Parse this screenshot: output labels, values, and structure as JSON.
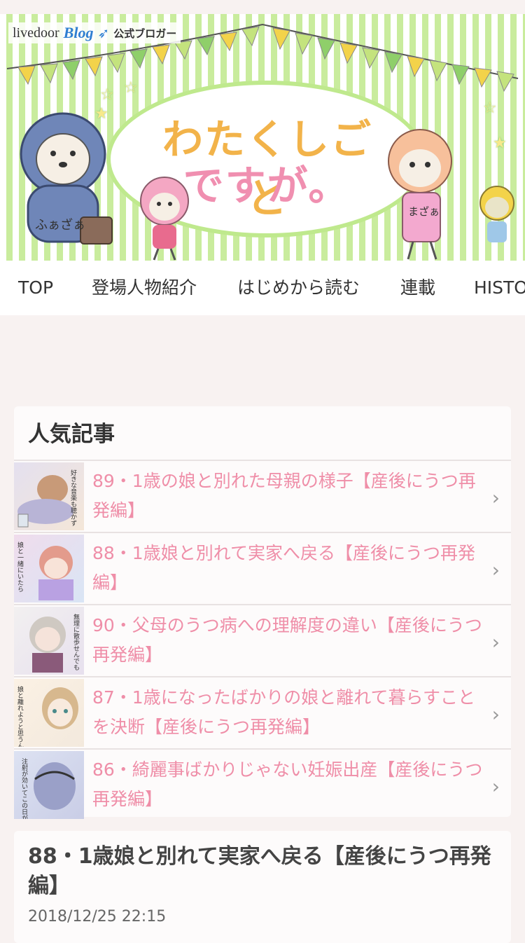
{
  "header": {
    "brand_livedoor": "livedoor",
    "brand_blog": "Blog",
    "brand_official": "公式ブロガー",
    "title_line1": "わたくしごと",
    "title_line2": "ですが。",
    "character_labels": [
      "ふぁざぁ",
      "まざぁ"
    ]
  },
  "nav": {
    "items": [
      "TOP",
      "登場人物紹介",
      "はじめから読む",
      "連載",
      "HISTORY"
    ]
  },
  "popular": {
    "title": "人気記事",
    "items": [
      {
        "text": "89・1歳の娘と別れた母親の様子【産後にうつ再発編】",
        "thumb_text": "好きな音楽も聴かず"
      },
      {
        "text": "88・1歳娘と別れて実家へ戻る【産後にうつ再発編】",
        "thumb_text": "娘と一緒にいたら"
      },
      {
        "text": "90・父母のうつ病への理解度の違い【産後にうつ再発編】",
        "thumb_text": "無理に散歩せんでも"
      },
      {
        "text": "87・1歳になったばかりの娘と離れて暮らすことを決断【産後にうつ再発編】",
        "thumb_text": "娘と離れようと思うんです"
      },
      {
        "text": "86・綺麗事ばかりじゃない妊娠出産【産後にうつ再発編】",
        "thumb_text": "注射が効いてこの日が夕方まで"
      }
    ]
  },
  "article": {
    "title": "88・1歳娘と別れて実家へ戻る【産後にうつ再発編】",
    "date": "2018/12/25 22:15"
  },
  "colors": {
    "link_pink": "#ef8ea8",
    "stripe_green": "#c9ec9d",
    "page_bg": "#f8f2f1"
  }
}
